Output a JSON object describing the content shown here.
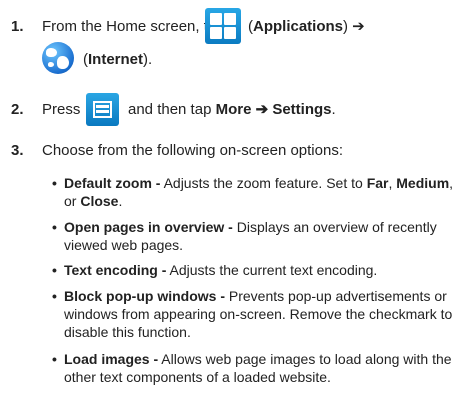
{
  "step1": {
    "num": "1.",
    "before": "From the Home screen, tap ",
    "open_paren": "(",
    "applications": "Applications",
    "close_arrow": ") ➔",
    "internet_open": "(",
    "internet": "Internet",
    "internet_close": ")."
  },
  "step2": {
    "num": "2.",
    "press": "Press",
    "then_tap": " and then tap ",
    "more_settings": "More ➔ Settings",
    "period": "."
  },
  "step3": {
    "num": "3.",
    "text": "Choose from the following on-screen options:"
  },
  "options": [
    {
      "name": "Default zoom -",
      "desc": " Adjusts the zoom feature. Set to ",
      "far": "Far",
      "comma": ", ",
      "medium": "Medium",
      "or": ", or ",
      "close": "Close",
      "end": "."
    },
    {
      "name": "Open pages in overview -",
      "desc": " Displays an overview of recently viewed web pages."
    },
    {
      "name": "Text encoding -",
      "desc": " Adjusts the current text encoding."
    },
    {
      "name": "Block pop-up windows -",
      "desc": " Prevents pop-up advertisements or windows from appearing on-screen. Remove the checkmark to disable this function."
    },
    {
      "name": "Load images -",
      "desc": " Allows web page images to load along with the other text components of a loaded website."
    }
  ],
  "icons": {
    "applications": "applications-grid-icon",
    "internet": "internet-globe-icon",
    "menu": "menu-key-icon"
  },
  "colors": {
    "icon_blue": "#0b7bc2",
    "text": "#222222"
  }
}
